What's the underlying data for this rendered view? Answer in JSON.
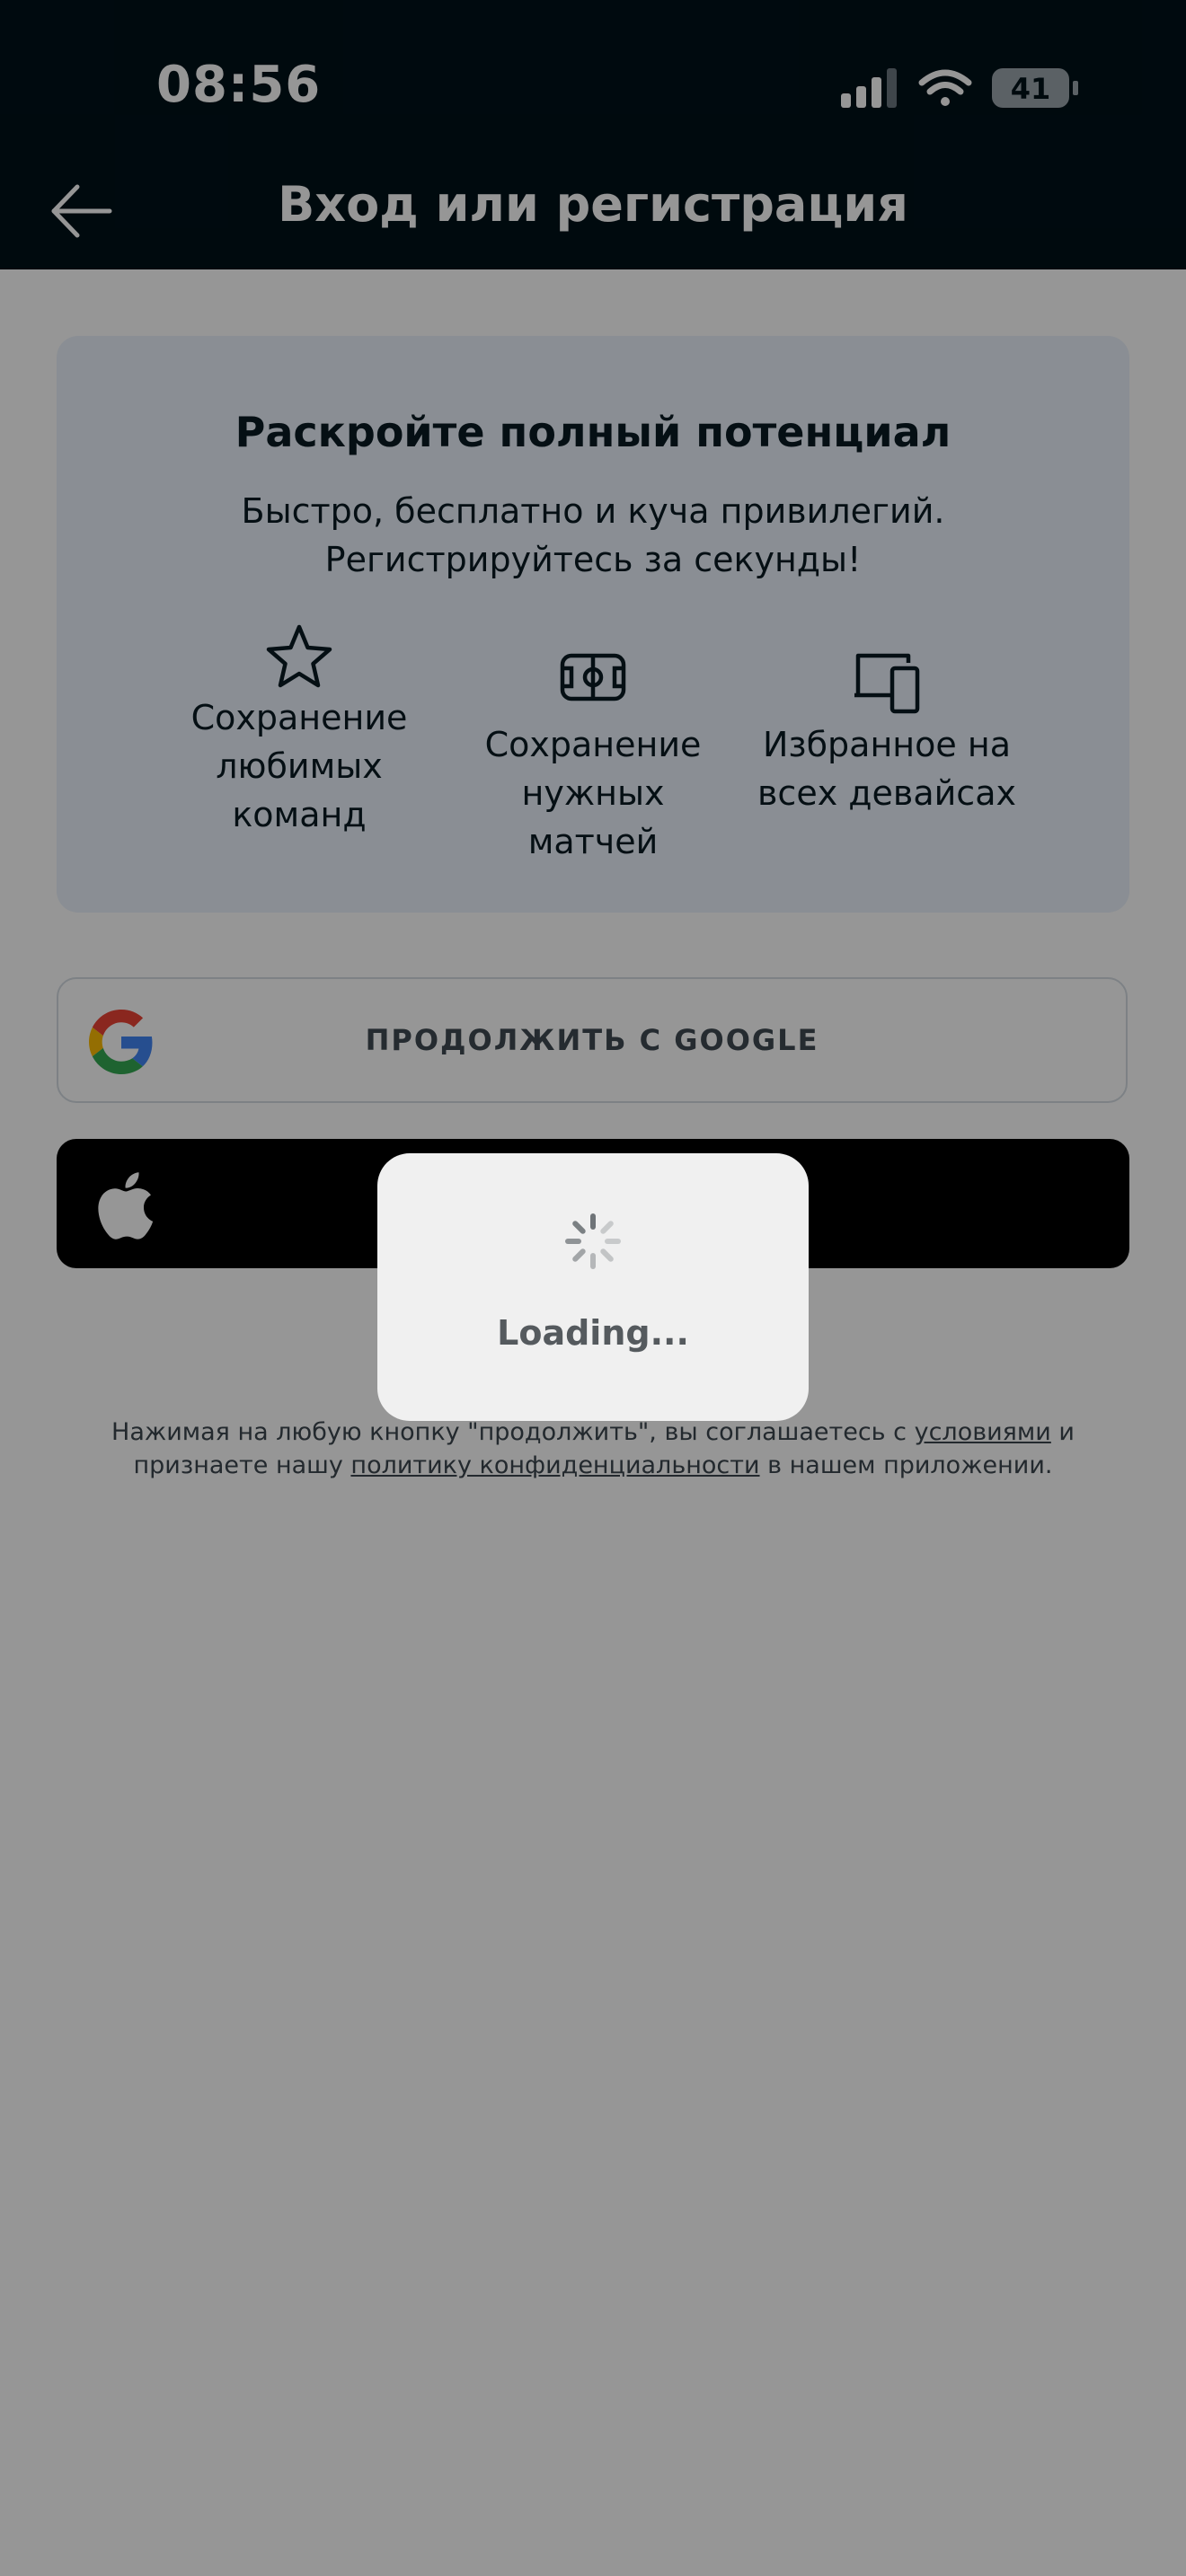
{
  "status_bar": {
    "time": "08:56",
    "battery": "41"
  },
  "header": {
    "title": "Вход или регистрация",
    "back_icon": "arrow-left-icon"
  },
  "promo": {
    "title": "Раскройте полный потенциал",
    "subtitle": "Быстро, бесплатно и куча привилегий. Регистрируйтесь за секунды!",
    "features": [
      {
        "icon": "star-icon",
        "label": "Сохранение\nлюбимых\nкоманд"
      },
      {
        "icon": "football-pitch-icon",
        "label": "Сохранение\nнужных матчей"
      },
      {
        "icon": "devices-icon",
        "label": "Избранное на\nвсех девайсах"
      }
    ]
  },
  "auth": {
    "google_label": "ПРОДОЛЖИТЬ С GOOGLE",
    "google_icon": "google-logo-icon",
    "apple_icon": "apple-logo-icon"
  },
  "legal": {
    "prefix": "Нажимая на любую кнопку \"продолжить\", вы соглашаетесь с",
    "terms_link": "условиями",
    "middle": "и признаете нашу",
    "privacy_link": "политику конфиденциальности",
    "suffix": "в нашем приложении."
  },
  "loading": {
    "label": "Loading...",
    "icon": "spinner-icon"
  },
  "colors": {
    "header_bg": "#001119",
    "card_bg": "#eaf2fb",
    "apple_button_bg": "#000000",
    "overlay": "rgba(0,0,0,0.41)"
  }
}
